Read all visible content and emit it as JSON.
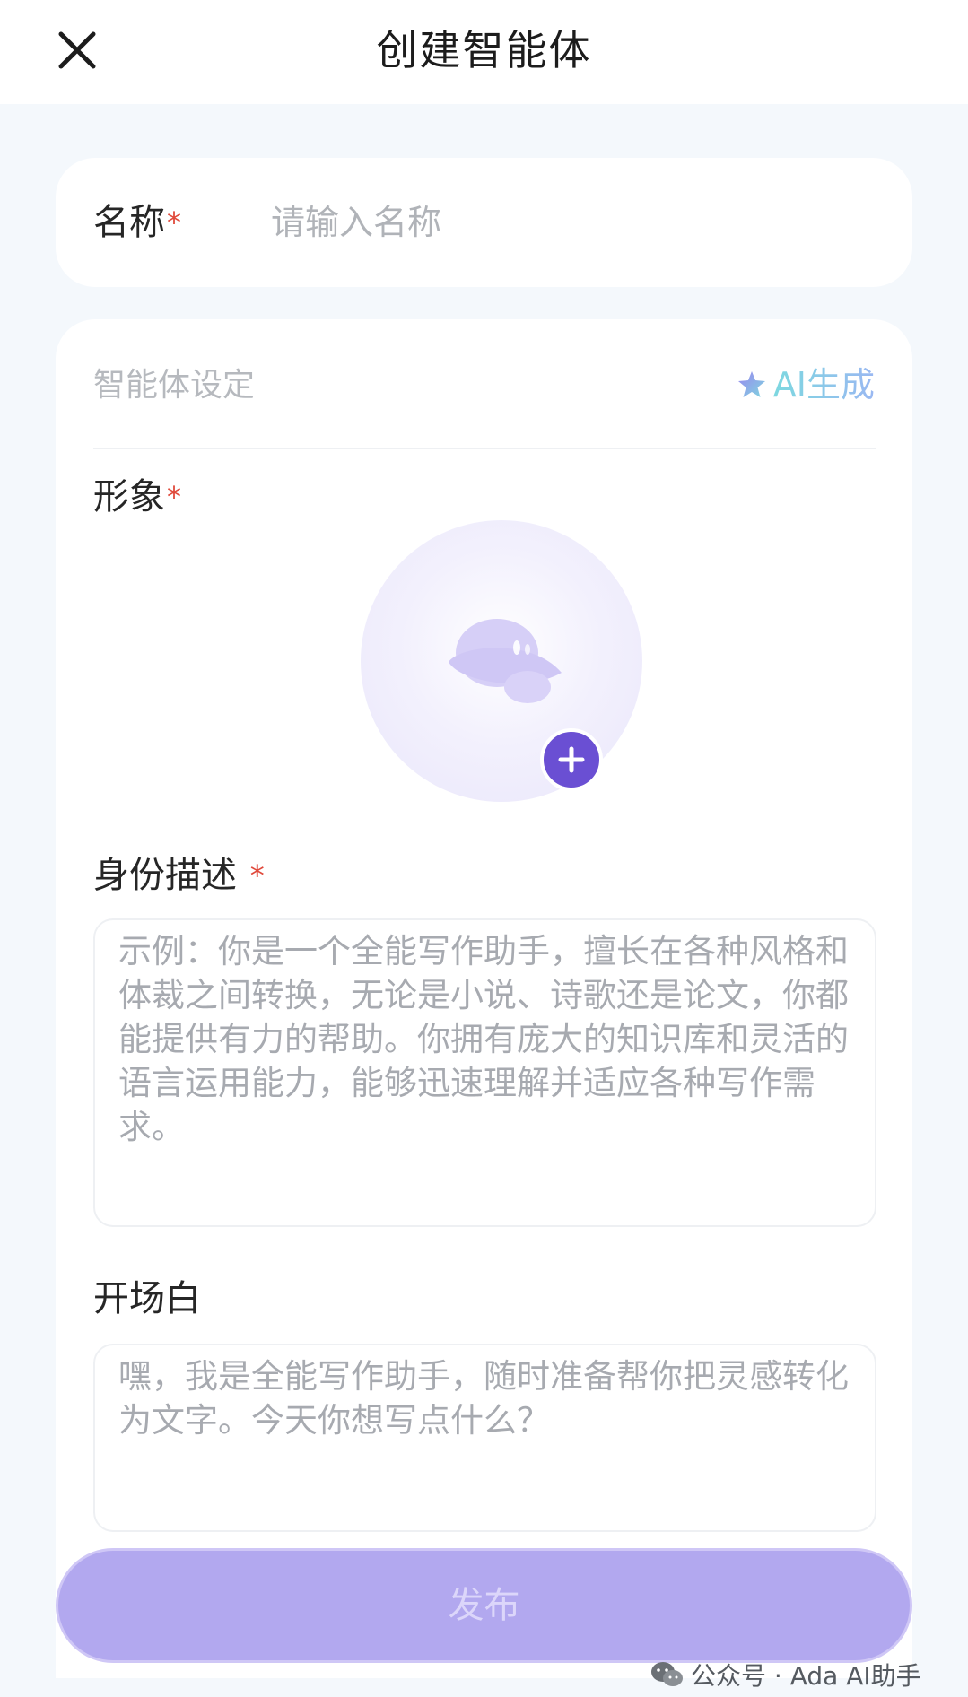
{
  "header": {
    "title": "创建智能体"
  },
  "name_field": {
    "label": "名称",
    "required_mark": "*",
    "placeholder": "请输入名称",
    "value": ""
  },
  "agent_settings": {
    "section_label": "智能体设定",
    "ai_generate_label": "AI生成",
    "avatar": {
      "label": "形象",
      "required_mark": "*"
    },
    "identity": {
      "label": "身份描述",
      "required_mark": "*",
      "placeholder": "示例：你是一个全能写作助手，擅长在各种风格和体裁之间转换，无论是小说、诗歌还是论文，你都能提供有力的帮助。你拥有庞大的知识库和灵活的语言运用能力，能够迅速理解并适应各种写作需求。"
    },
    "opening": {
      "label": "开场白",
      "placeholder": "嘿，我是全能写作助手，随时准备帮你把灵感转化为文字。今天你想写点什么？"
    }
  },
  "footer": {
    "publish_label": "发布",
    "watermark": "公众号 · Ada AI助手"
  },
  "colors": {
    "accent": "#6a4fd3",
    "publish_bg": "#b2a8ef",
    "required": "#e0493b",
    "page_bg": "#f4f8fc"
  },
  "icons": {
    "close": "close-icon",
    "ai": "sparkle-star-icon",
    "avatar": "planet-icon",
    "add": "plus-icon",
    "watermark": "wechat-icon"
  }
}
